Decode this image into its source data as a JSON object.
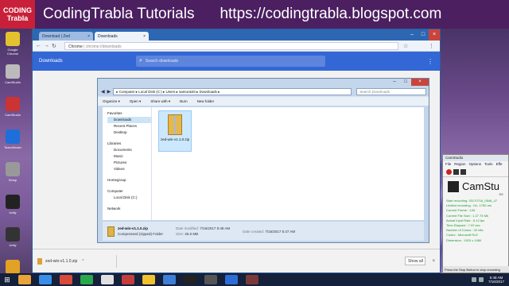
{
  "banner": {
    "logo_line1": "CODING",
    "logo_line2": "Trabla",
    "title": "CodingTrabla Tutorials",
    "url": "https://codingtrabla.blogspot.com"
  },
  "desktop_icons": [
    {
      "label": "Google Chrome",
      "color": "#e4c12f"
    },
    {
      "label": "CamStudio",
      "color": "#bbbbbb"
    },
    {
      "label": "CamStudio",
      "color": "#cc3333"
    },
    {
      "label": "TeamViewer",
      "color": "#1e6fd9"
    },
    {
      "label": "Setup",
      "color": "#999999"
    },
    {
      "label": "Unity",
      "color": "#222222"
    },
    {
      "label": "Unity",
      "color": "#333333"
    },
    {
      "label": "BACKUP",
      "color": "#e2a226"
    }
  ],
  "chrome": {
    "tabs": [
      {
        "label": "Download | Zed",
        "close": "×"
      },
      {
        "label": "Downloads",
        "close": "×"
      }
    ],
    "omnibox": {
      "scheme": "Chrome",
      "sep": " | ",
      "path": "chrome://downloads"
    },
    "page_title": "Downloads",
    "search_placeholder": "Search downloads",
    "shelf": {
      "filename": "zed-win-v1.1.0.zip",
      "show_all": "Show all"
    }
  },
  "explorer": {
    "breadcrumb": "▸ Computer ▸ Local Disk (C:) ▸ Users ▸ samurai4it ▸ Downloads ▸",
    "search_placeholder": "Search Downloads",
    "toolbar": [
      "Organize ▾",
      "Open ▾",
      "Share with ▾",
      "Burn",
      "New folder"
    ],
    "nav": [
      {
        "label": "Favorites",
        "cls": ""
      },
      {
        "label": "Downloads",
        "cls": "sub sel"
      },
      {
        "label": "Recent Places",
        "cls": "sub"
      },
      {
        "label": "Desktop",
        "cls": "sub"
      },
      {
        "label": "Libraries",
        "cls": "gap"
      },
      {
        "label": "Documents",
        "cls": "sub"
      },
      {
        "label": "Music",
        "cls": "sub"
      },
      {
        "label": "Pictures",
        "cls": "sub"
      },
      {
        "label": "Videos",
        "cls": "sub"
      },
      {
        "label": "Homegroup",
        "cls": "gap"
      },
      {
        "label": "Computer",
        "cls": "gap"
      },
      {
        "label": "Local Disk (C:)",
        "cls": "sub"
      },
      {
        "label": "Network",
        "cls": "gap"
      }
    ],
    "file": {
      "name": "zed-win-v1.1.0.zip"
    },
    "details": {
      "name": "zed-win-v1.1.0.zip",
      "type": "Compressed (zipped) Folder",
      "modified_label": "Date modified:",
      "modified": "7/16/2017 5:48 AM",
      "size_label": "Size:",
      "size": "26.0 MB",
      "created_label": "Date created:",
      "created": "7/16/2017 5:47 AM"
    }
  },
  "camstudio": {
    "title": "CamStudio",
    "menu": [
      "File",
      "Region",
      "Options",
      "Tools",
      "Effe"
    ],
    "name": "CamStu",
    "rec": "RE",
    "stats": [
      "Start recording: 20170716_0548_47",
      "Limited recording : On, 1750 ms",
      "Current Frame : 149",
      "Current File Size : 1.27 75 Mb",
      "Actual Input Rate : 6.12 fps",
      "Time Elapsed : 7.02 sec",
      "Number of Colors : 32 bits",
      "Codec : Microsoft RLE",
      "Dimension : 1920 x 1080"
    ],
    "footer": "Press the Stop Button to stop recording"
  },
  "taskbar": {
    "icons": [
      "#e8a33a",
      "#3a8ee8",
      "#d84a3a",
      "#2aa84a",
      "#e0e0e0",
      "#c43d3d",
      "#f2c12e",
      "#3f7fd8",
      "#222222",
      "#555555",
      "#2d6ed6",
      "#7a3a3a"
    ],
    "time": "5:48 AM",
    "date": "7/16/2017"
  }
}
